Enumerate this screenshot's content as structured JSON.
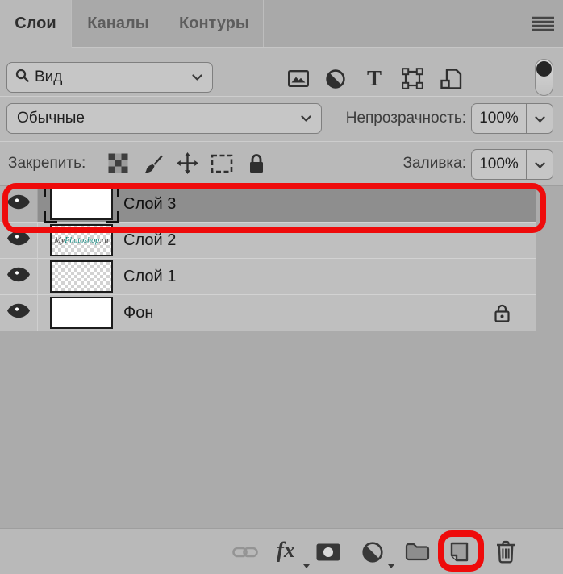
{
  "tabs": [
    {
      "label": "Слои",
      "active": true
    },
    {
      "label": "Каналы",
      "active": false
    },
    {
      "label": "Контуры",
      "active": false
    }
  ],
  "filter_row": {
    "search_value": "Вид"
  },
  "blend_row": {
    "mode": "Обычные",
    "opacity_label": "Непрозрачность:",
    "opacity_value": "100%"
  },
  "lock_row": {
    "label": "Закрепить:",
    "fill_label": "Заливка:",
    "fill_value": "100%"
  },
  "layers": [
    {
      "name": "Слой 3",
      "selected": true,
      "visible": true,
      "thumb": "white-with-selection-brackets"
    },
    {
      "name": "Слой 2",
      "selected": false,
      "visible": true,
      "thumb": "logo-on-transparent",
      "thumb_text": {
        "my": "My",
        "photoshop": "Photoshop",
        "ru": ".ru"
      }
    },
    {
      "name": "Слой 1",
      "selected": false,
      "visible": true,
      "thumb": "transparent"
    },
    {
      "name": "Фон",
      "selected": false,
      "visible": true,
      "locked": true,
      "thumb": "white"
    }
  ],
  "bottom_bar": {
    "fx_label": "fx"
  },
  "icons": {
    "panel-menu-icon": "hamburger-lines",
    "search-icon": "magnifier",
    "chevron-down-icon": "v-chevron",
    "filter-pixel-layers-icon": "photo-in-frame",
    "filter-adjustment-layers-icon": "half-filled-circle",
    "filter-type-layers-icon": "letter-T",
    "filter-shape-layers-icon": "square-with-anchor-points",
    "filter-smart-objects-icon": "page-with-small-square",
    "filter-toggle-switch": "vertical-pill-switch",
    "lock-transparency-icon": "checkerboard",
    "lock-pixels-icon": "brush",
    "lock-position-icon": "four-way-move-arrows",
    "lock-artboard-icon": "dashed-frame",
    "lock-all-icon": "filled-padlock",
    "visibility-eye-icon": "eye",
    "layer-locked-icon": "outlined-padlock-with-dot",
    "link-layers-icon": "chain-links",
    "layer-style-icon": "fx-text",
    "add-layer-mask-icon": "dark-rectangle-with-circle",
    "new-adjustment-layer-icon": "half-filled-circle",
    "new-group-icon": "folder",
    "new-layer-icon": "sheet-with-folded-corner",
    "delete-layer-icon": "trash-can"
  },
  "colors": {
    "annotation_red": "#ee0b0b",
    "selected_row": "#8e8e8e",
    "logo_teal": "#0d8a80",
    "panel_bg": "#b9b9b9",
    "tabbar_bg": "#a9a9a9"
  }
}
